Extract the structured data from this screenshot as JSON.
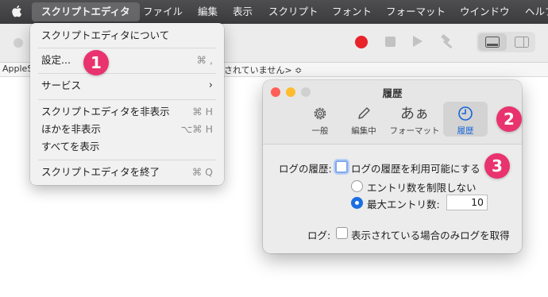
{
  "menubar": {
    "items": [
      "スクリプトエディタ",
      "ファイル",
      "編集",
      "表示",
      "スクリプト",
      "フォント",
      "フォーマット",
      "ウインドウ",
      "ヘルプ"
    ]
  },
  "pathbar": {
    "left": "AppleS",
    "middle": "されていません> ≎"
  },
  "app_menu": {
    "items": [
      {
        "label": "スクリプトエディタについて",
        "shortcut": ""
      },
      {
        "label": "設定...",
        "shortcut": "⌘ ,"
      },
      {
        "label": "サービス",
        "shortcut": "›"
      },
      {
        "label": "スクリプトエディタを非表示",
        "shortcut": "⌘ H"
      },
      {
        "label": "ほかを非表示",
        "shortcut": "⌥⌘ H"
      },
      {
        "label": "すべてを表示",
        "shortcut": ""
      },
      {
        "label": "スクリプトエディタを終了",
        "shortcut": "⌘ Q"
      }
    ]
  },
  "badges": [
    "1",
    "2",
    "3"
  ],
  "prefs": {
    "title": "履歴",
    "tabs": [
      {
        "label": "一般",
        "icon": "gear-icon"
      },
      {
        "label": "編集中",
        "icon": "pencil-icon"
      },
      {
        "label": "フォーマット",
        "icon": "text-format-icon",
        "glyph": "あぁ"
      },
      {
        "label": "履歴",
        "icon": "clock-icon",
        "selected": true
      }
    ],
    "history_label": "ログの履歴:",
    "enable_history": "ログの履歴を利用可能にする",
    "unlimited": "エントリ数を制限しない",
    "max_entries": "最大エントリ数:",
    "max_entries_value": "10",
    "log_label": "ログ:",
    "log_only_visible": "表示されている場合のみログを取得"
  },
  "colors": {
    "accent": "#1a6fe0",
    "badge": "#e8336e",
    "record": "#e8232a"
  }
}
